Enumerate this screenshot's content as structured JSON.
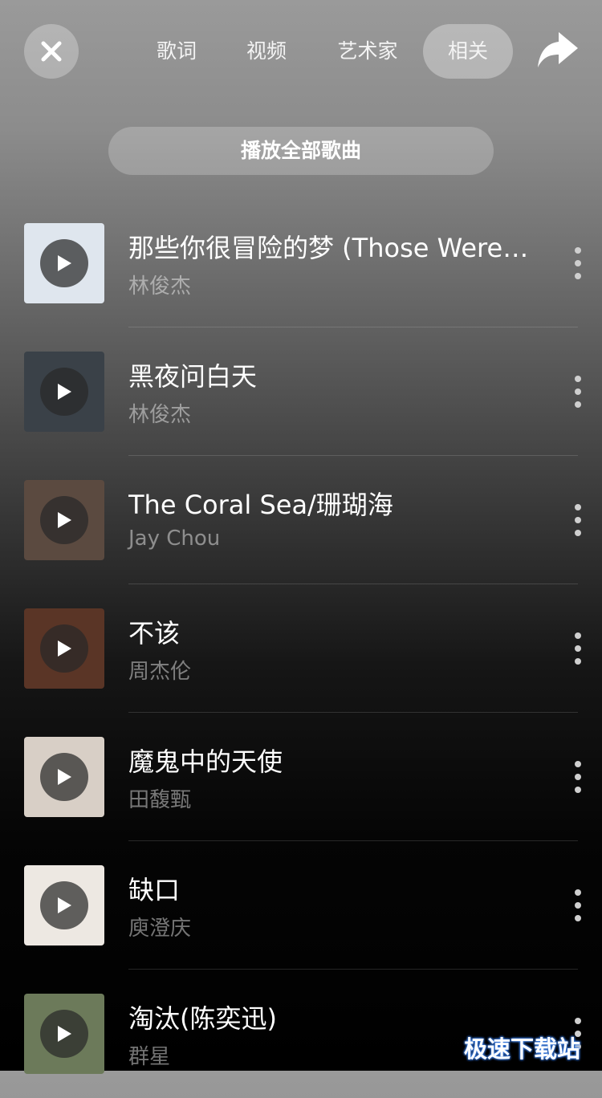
{
  "header": {
    "tabs": [
      {
        "label": "歌词"
      },
      {
        "label": "视频"
      },
      {
        "label": "艺术家"
      },
      {
        "label": "相关",
        "active": true
      }
    ],
    "close_icon": "close-icon",
    "share_icon": "share-arrow-icon"
  },
  "play_all_label": "播放全部歌曲",
  "songs": [
    {
      "title": "那些你很冒险的梦 (Those Were…",
      "artist": "林俊杰",
      "art_color": "#dfe6ee"
    },
    {
      "title": "黑夜问白天",
      "artist": "林俊杰",
      "art_color": "#3a4148"
    },
    {
      "title": "The Coral Sea/珊瑚海",
      "artist": "Jay Chou",
      "art_color": "#5b4a40"
    },
    {
      "title": "不该",
      "artist": "周杰伦",
      "art_color": "#5a3526"
    },
    {
      "title": "魔鬼中的天使",
      "artist": "田馥甄",
      "art_color": "#d8cfc6"
    },
    {
      "title": "缺口",
      "artist": "庾澄庆",
      "art_color": "#ede8e2"
    },
    {
      "title": "淘汰(陈奕迅)",
      "artist": "群星",
      "art_color": "#6c7a5a"
    }
  ],
  "watermark": "极速下载站"
}
